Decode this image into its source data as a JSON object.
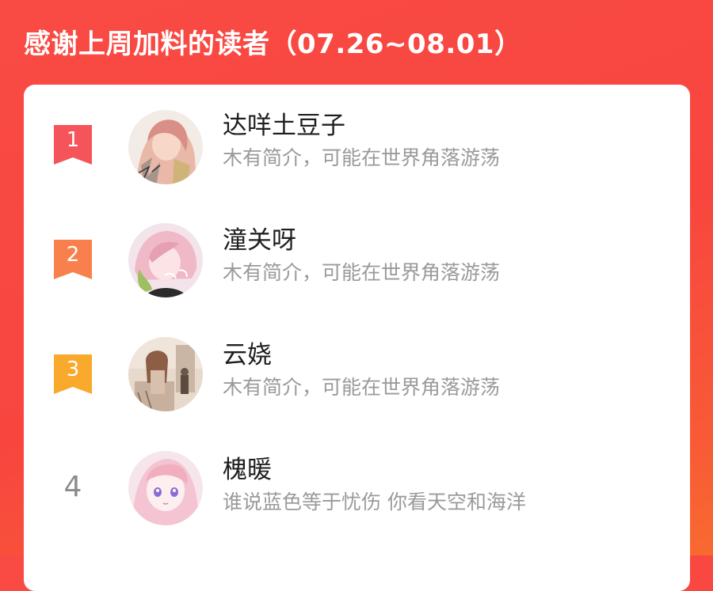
{
  "header": {
    "title": "感谢上周加料的读者（07.26~08.01）"
  },
  "colors": {
    "background": "#f94a44",
    "rank_1": "#f5545a",
    "rank_2": "#f8804d",
    "rank_3": "#f9a92b",
    "name_text": "#1f1f1f",
    "bio_text": "#9a9a9a"
  },
  "readers": [
    {
      "rank": "1",
      "name": "达咩土豆子",
      "bio": "木有简介，可能在世界角落游荡",
      "avatar_icon": "anime-girl-sketch-avatar"
    },
    {
      "rank": "2",
      "name": "潼关呀",
      "bio": "木有简介，可能在世界角落游荡",
      "avatar_icon": "pink-hair-girl-avatar"
    },
    {
      "rank": "3",
      "name": "云娆",
      "bio": "木有简介，可能在世界角落游荡",
      "avatar_icon": "street-scene-avatar"
    },
    {
      "rank": "4",
      "name": "槐暖",
      "bio": "谁说蓝色等于忧伤 你看天空和海洋",
      "avatar_icon": "purple-eyes-girl-avatar"
    }
  ]
}
